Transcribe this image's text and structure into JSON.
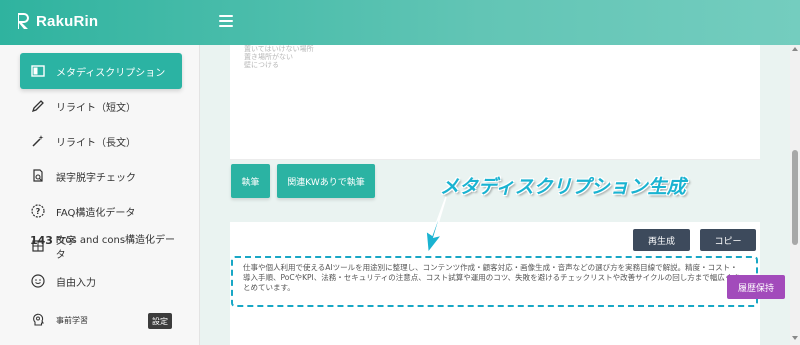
{
  "app": {
    "name": "RakuRin",
    "brand_color": "#2bb3a3"
  },
  "sidebar": {
    "items": [
      {
        "label": "メタディスクリプション",
        "icon": "layout-icon",
        "active": true
      },
      {
        "label": "リライト（短文）",
        "icon": "pencil-icon"
      },
      {
        "label": "リライト（長文）",
        "icon": "magic-wand-icon"
      },
      {
        "label": "誤字脱字チェック",
        "icon": "document-search-icon"
      },
      {
        "label": "FAQ構造化データ",
        "icon": "question-icon"
      },
      {
        "label": "Pros and cons構造化データ",
        "icon": "grid-icon"
      },
      {
        "label": "自由入力",
        "icon": "smile-icon"
      },
      {
        "label": "事前学習",
        "icon": "brain-icon"
      }
    ],
    "settings_label": "設定"
  },
  "editor": {
    "placeholder_lines": [
      "置いてはいけない場所",
      "置き場所がない",
      "壁につける"
    ]
  },
  "actions": {
    "write_label": "執筆",
    "write_with_kw_label": "関連KWありで執筆"
  },
  "result": {
    "count_value": "143",
    "count_unit": "文字",
    "regenerate_label": "再生成",
    "copy_label": "コピー",
    "text": "仕事や個人利用で使えるAIツールを用途別に整理し、コンテンツ作成・顧客対応・画像生成・音声などの選び方を実務目線で解説。精度・コスト・導入手順、PoCやKPI、法務・セキュリティの注意点、コスト試算や運用のコツ、失敗を避けるチェックリストや改善サイクルの回し方まで幅広くまとめています。",
    "save_history_label": "履歴保持"
  },
  "annotation": {
    "text": "メタディスクリプション生成",
    "color": "#1ab3d1"
  }
}
